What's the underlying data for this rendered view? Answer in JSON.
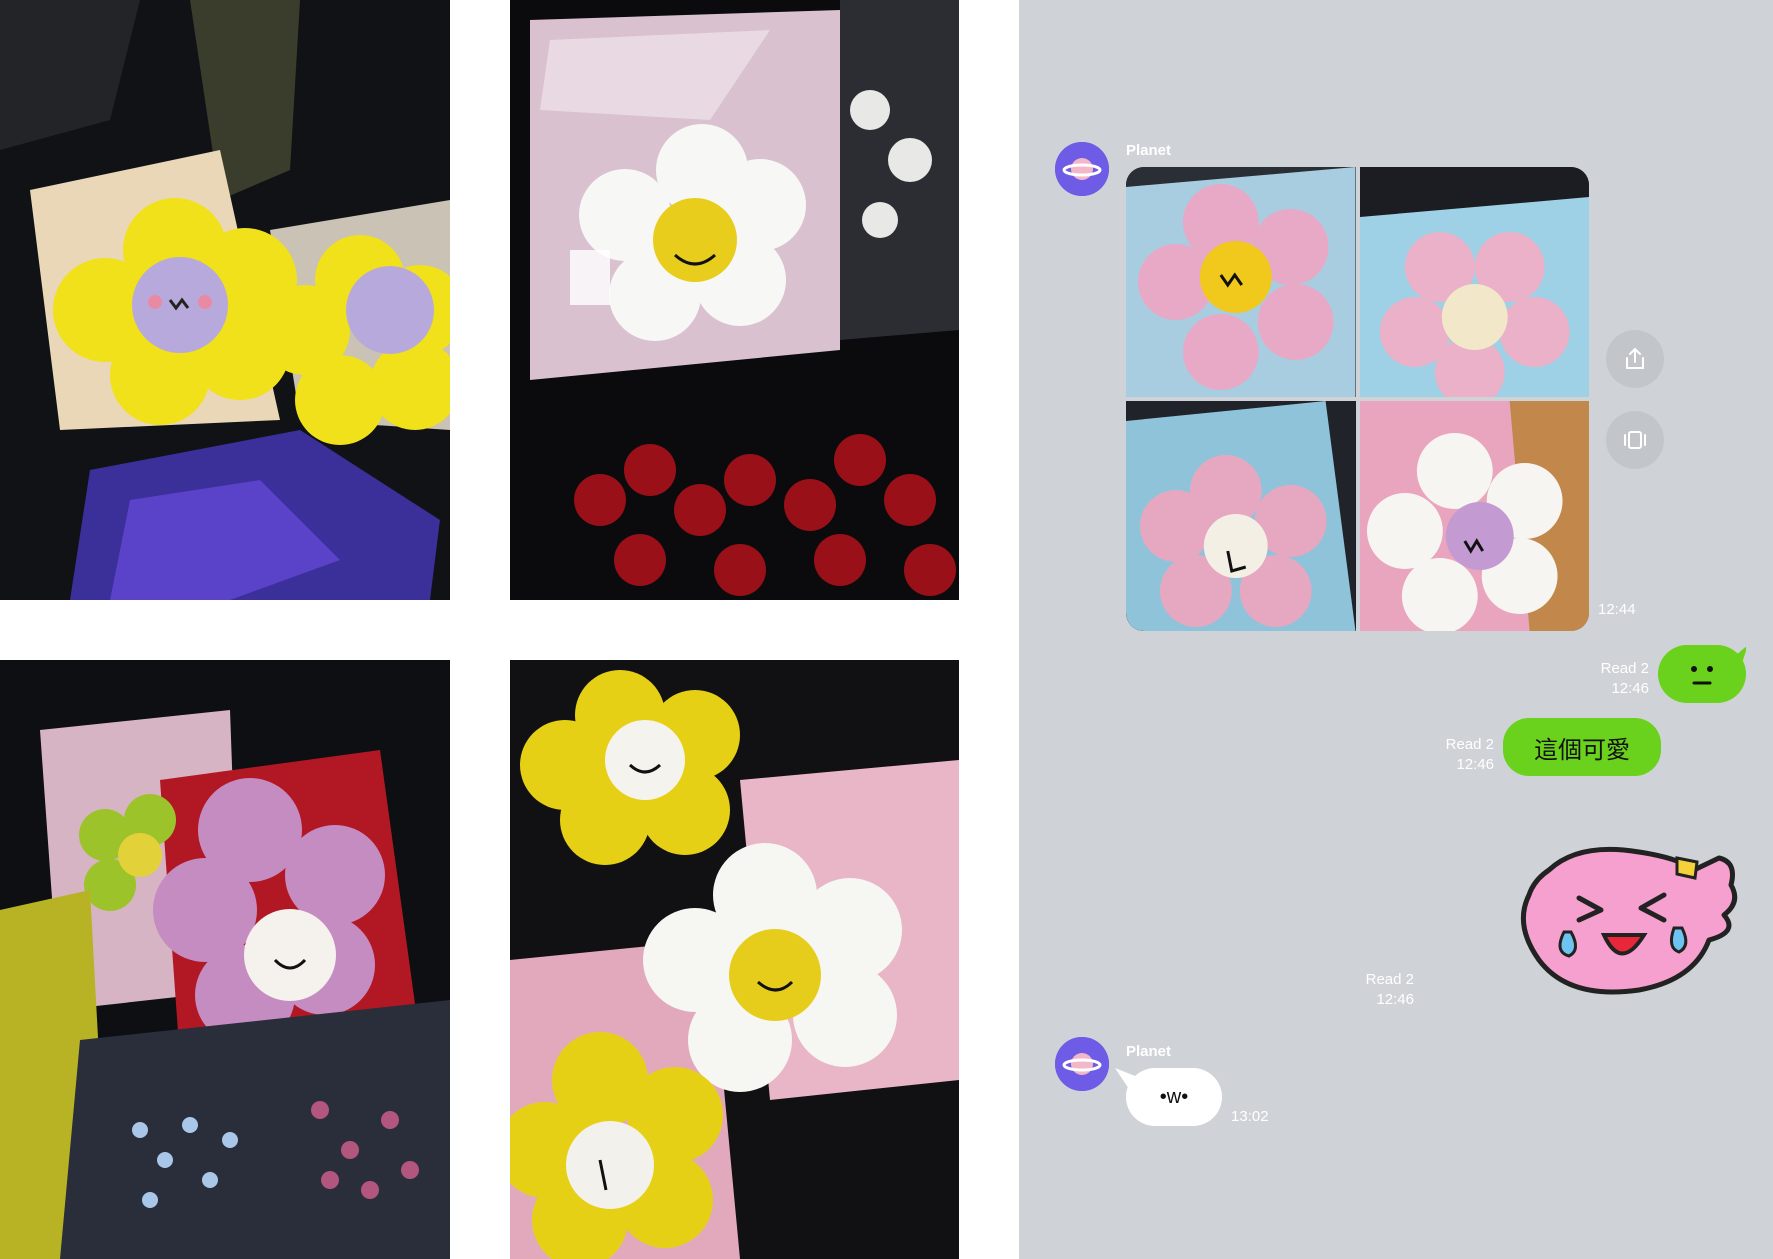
{
  "chat": {
    "messages": {
      "m1": {
        "sender": "Planet",
        "time": "12:44"
      },
      "m2": {
        "read": "Read 2",
        "time": "12:46"
      },
      "m3": {
        "read": "Read 2",
        "time": "12:46",
        "text": "這個可愛"
      },
      "m4": {
        "read": "Read 2",
        "time": "12:46"
      },
      "m5": {
        "sender": "Planet",
        "text": "•w•",
        "time": "13:02"
      }
    }
  },
  "icons": {
    "share": "share-icon",
    "carousel": "carousel-icon",
    "avatar": "planet-icon"
  },
  "colors": {
    "chat_bg": "#cfd3d7",
    "bubble_green": "#6ad11d",
    "avatar_purple": "#6e5ce6"
  }
}
